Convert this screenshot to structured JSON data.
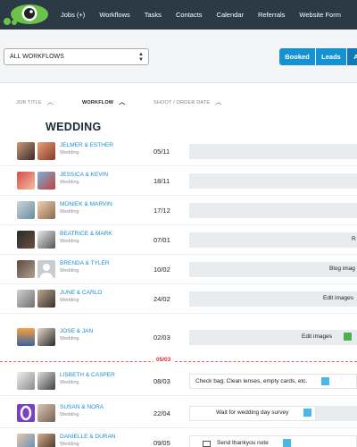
{
  "nav": {
    "items": [
      "Jobs (+)",
      "Workflows",
      "Tasks",
      "Contacts",
      "Calendar",
      "Referrals",
      "Website Form"
    ]
  },
  "filter": {
    "selected": "ALL WORKFLOWS"
  },
  "segments": {
    "booked": "Booked",
    "leads": "Leads",
    "all": "A"
  },
  "columns": {
    "job_title": "JOB TITLE",
    "workflow": "WORKFLOW",
    "date": "SHOOT / ORDER DATE"
  },
  "section": {
    "title": "WEDDING"
  },
  "today_marker": "05/03",
  "rows": [
    {
      "names": "JELMER & ESTHER",
      "type": "Wedding",
      "date": "05/11",
      "task": ""
    },
    {
      "names": "JESSICA & KEVIN",
      "type": "Wedding",
      "date": "18/11",
      "task": ""
    },
    {
      "names": "MONIEK & MARVIN",
      "type": "Wedding",
      "date": "17/12",
      "task": ""
    },
    {
      "names": "BEATRICE & MARK",
      "type": "Wedding",
      "date": "07/01",
      "task": "R"
    },
    {
      "names": "BRENDA & TYLER",
      "type": "Wedding",
      "date": "10/02",
      "task": "Blog imag"
    },
    {
      "names": "JUNE & CARLO",
      "type": "Wedding",
      "date": "24/02",
      "task": "Edit images"
    },
    {
      "names": "JOSE & JAN",
      "type": "Wedding",
      "date": "02/03",
      "task": "Edit images"
    },
    {
      "names": "LISBETH & CASPER",
      "type": "Wedding",
      "date": "08/03",
      "task": "Check bag; Clean lenses, empty cards, etc."
    },
    {
      "names": "SUSAN & NORA",
      "type": "Wedding",
      "date": "22/04",
      "task": "Wait for wedding day survey"
    },
    {
      "names": "DANIELLE & DURAN",
      "type": "Wedding",
      "date": "09/05",
      "task": "Send thankyou note"
    }
  ],
  "colors": {
    "nav_bg": "#2c3a46",
    "accent": "#1592d4",
    "link": "#1a8fcf",
    "check_green": "#4caf50",
    "check_blue": "#4db6e8",
    "today_red": "#d32f2f"
  }
}
